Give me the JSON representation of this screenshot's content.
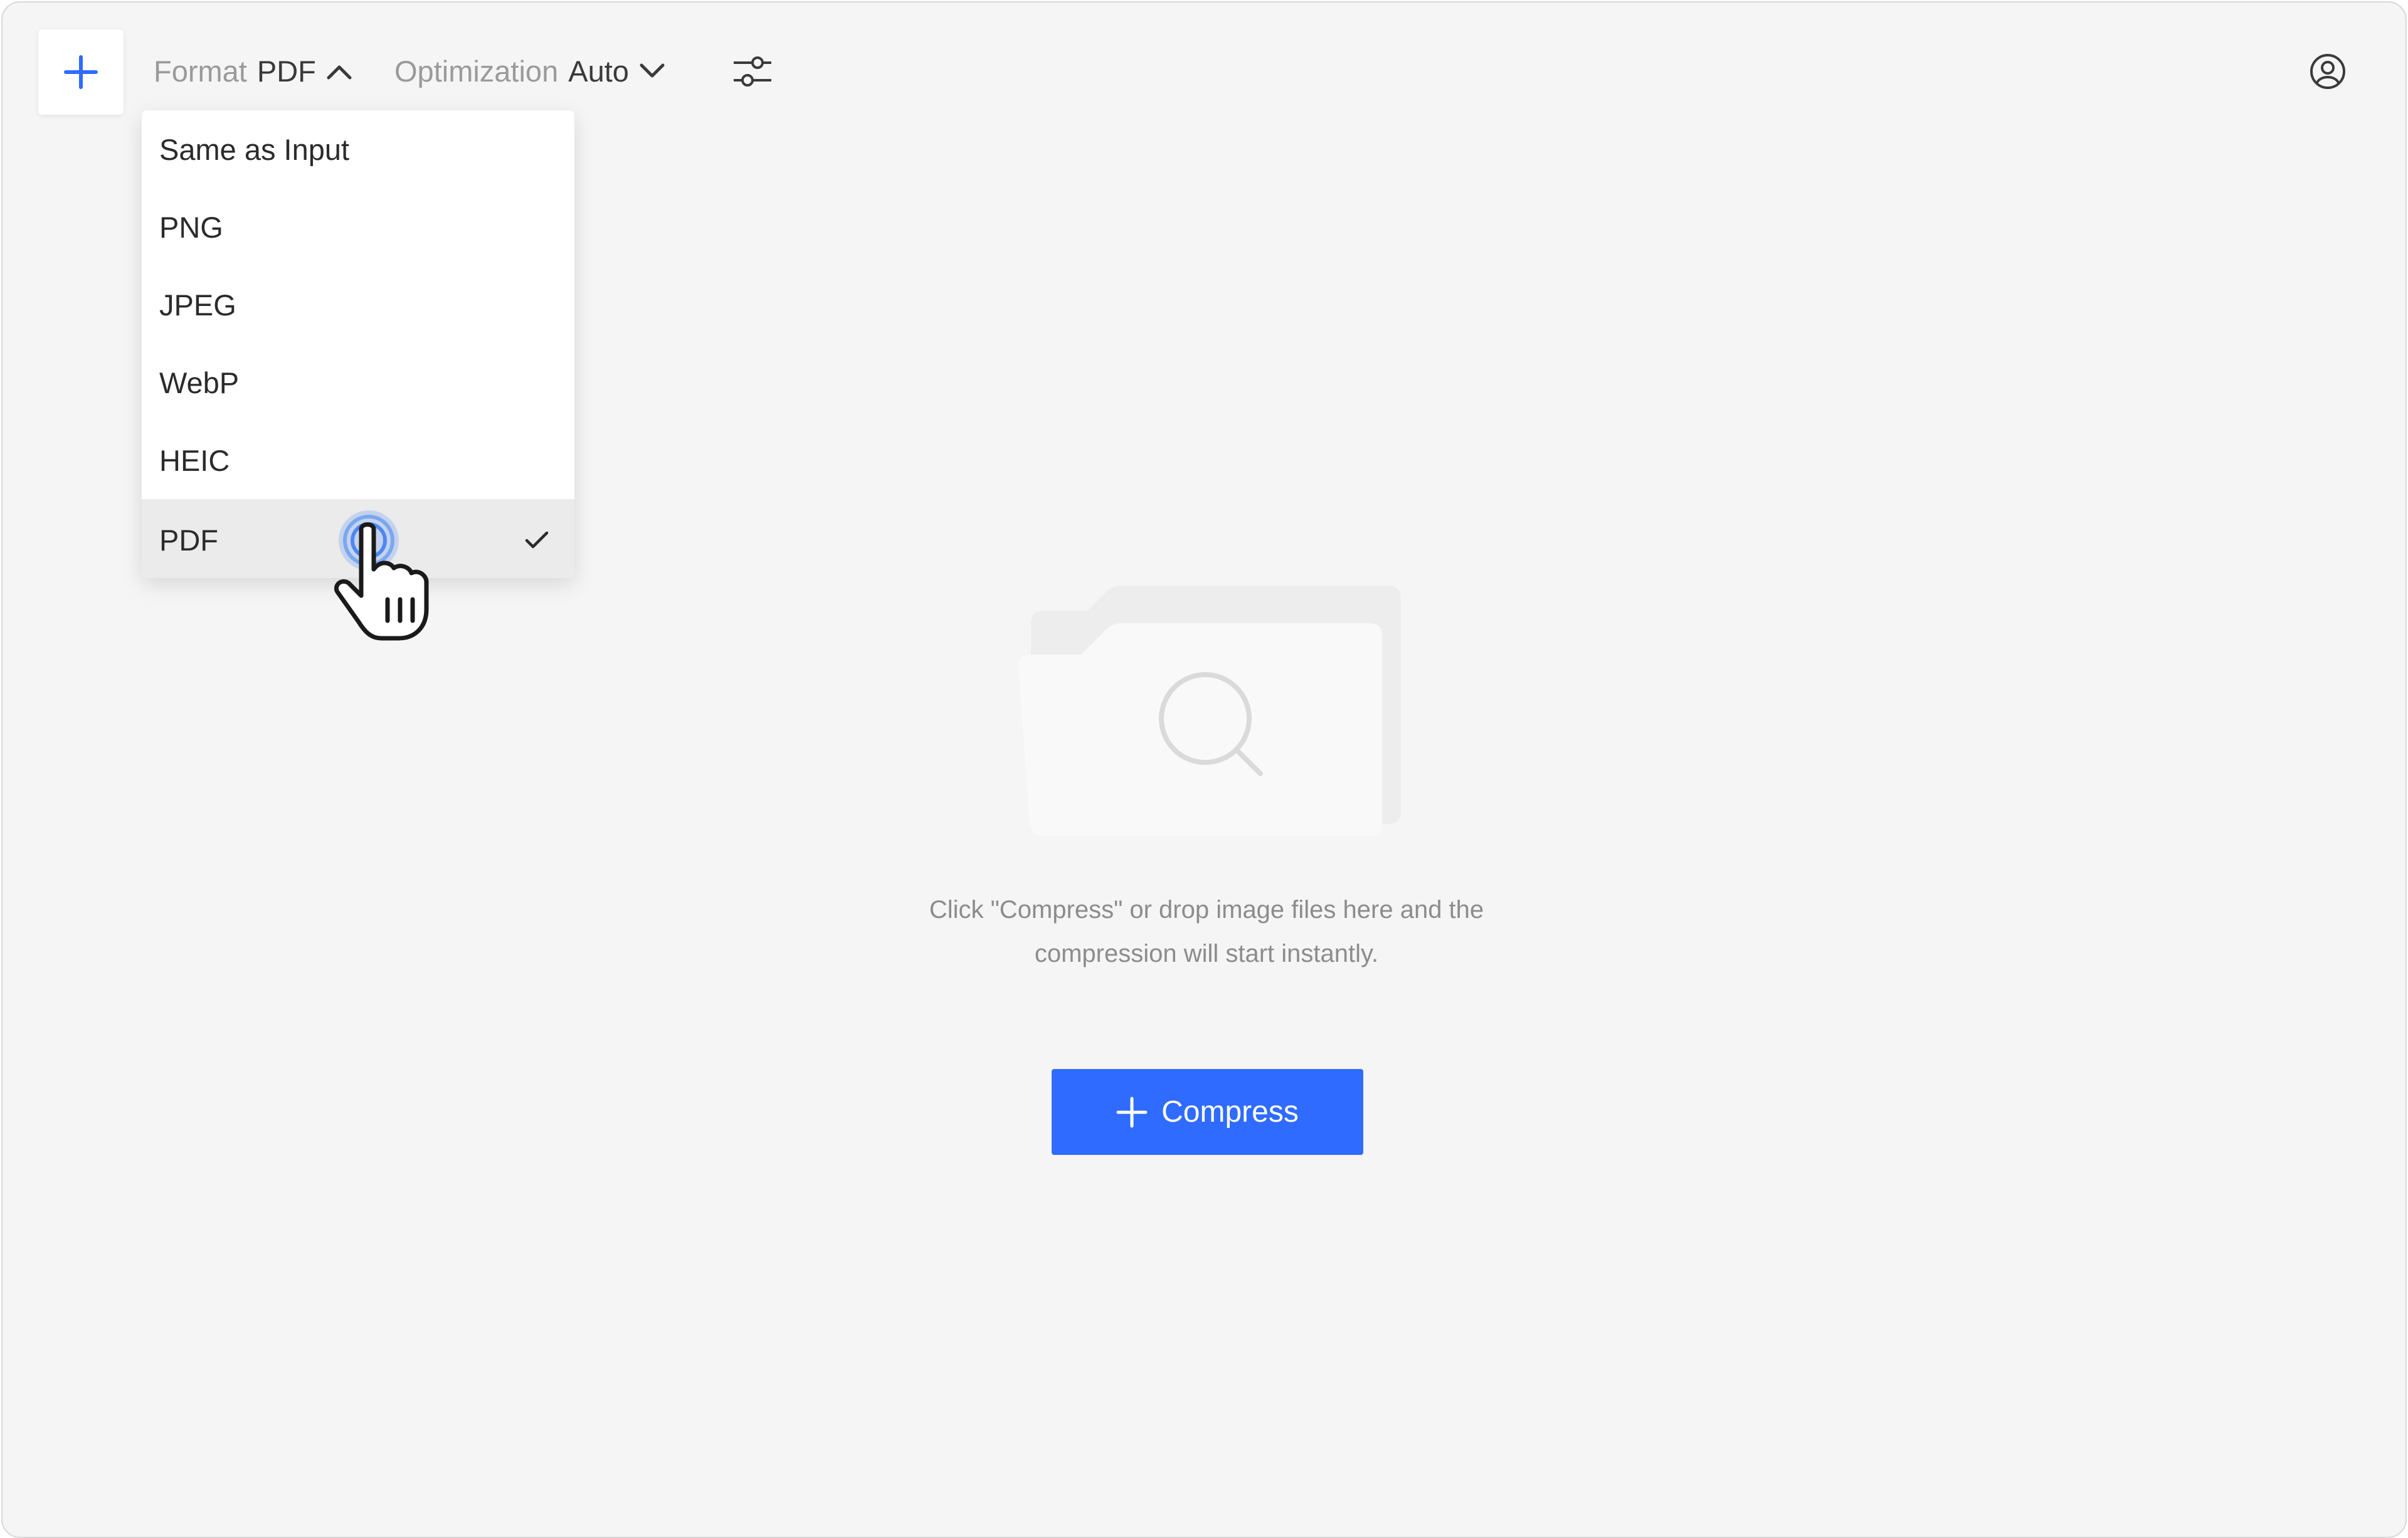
{
  "toolbar": {
    "format": {
      "label": "Format",
      "value": "PDF",
      "icon": "chevron-up-icon"
    },
    "optimization": {
      "label": "Optimization",
      "value": "Auto",
      "icon": "chevron-down-icon"
    },
    "add_icon": "plus-icon",
    "settings_icon": "sliders-icon",
    "user_icon": "user-circle-icon"
  },
  "format_menu": {
    "items": [
      {
        "label": "Same as Input"
      },
      {
        "label": "PNG"
      },
      {
        "label": "JPEG"
      },
      {
        "label": "WebP"
      },
      {
        "label": "HEIC"
      },
      {
        "label": "PDF",
        "selected": true
      }
    ]
  },
  "empty_state": {
    "icon": "folder-search-icon",
    "message_line1": "Click \"Compress\" or drop image files here and the",
    "message_line2": "compression will start instantly."
  },
  "compress_button": {
    "label": "Compress",
    "icon": "plus-icon"
  },
  "colors": {
    "accent": "#2f6bff",
    "background": "#f5f5f5",
    "selected_item": "#ebebeb",
    "cursor_highlight": "#7ba7f0"
  }
}
